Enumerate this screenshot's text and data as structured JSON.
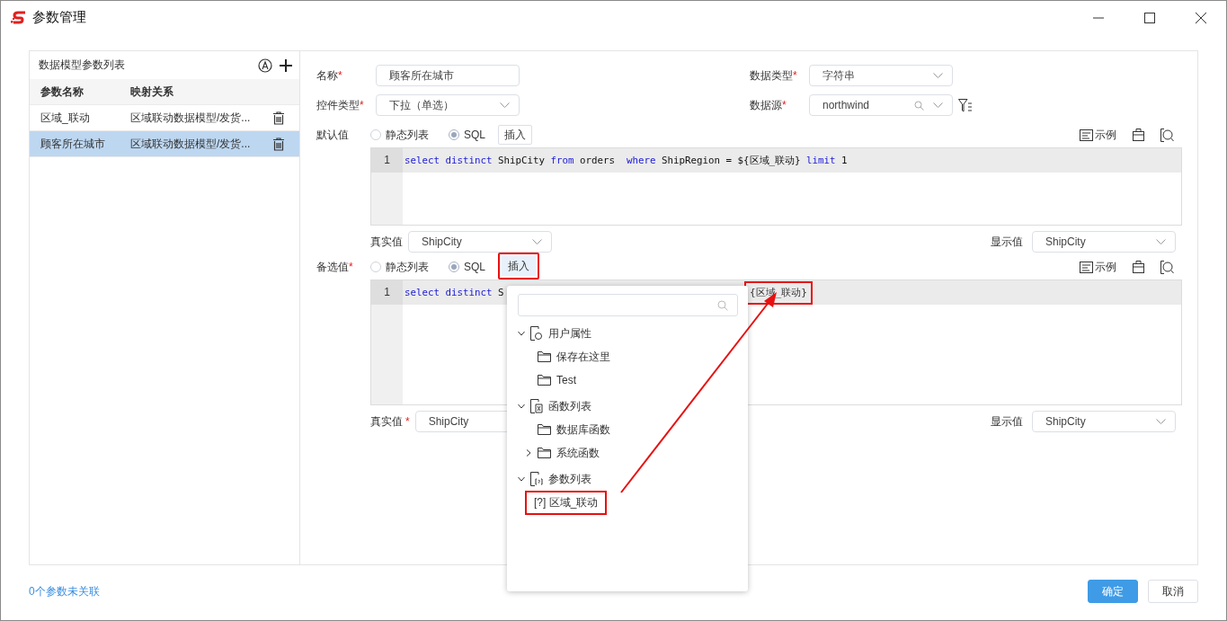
{
  "window": {
    "title": "参数管理"
  },
  "param_list": {
    "title": "数据模型参数列表",
    "columns": [
      "参数名称",
      "映射关系"
    ],
    "rows": [
      {
        "name": "区域_联动",
        "mapping": "区域联动数据模型/发货...",
        "selected": false
      },
      {
        "name": "顾客所在城市",
        "mapping": "区域联动数据模型/发货...",
        "selected": true
      }
    ]
  },
  "form": {
    "name": {
      "label": "名称",
      "required_mark": "*",
      "value": "顾客所在城市"
    },
    "data_type": {
      "label": "数据类型",
      "required_mark": "*",
      "value": "字符串"
    },
    "control_type": {
      "label": "控件类型",
      "required_mark": "*",
      "value": "下拉（单选）"
    },
    "data_source": {
      "label": "数据源",
      "required_mark": "*",
      "value": "northwind"
    }
  },
  "sections": [
    {
      "label": "默认值",
      "options": [
        {
          "label": "静态列表",
          "selected": false
        },
        {
          "label": "SQL",
          "selected": true
        }
      ],
      "insert_button": {
        "label": "插入",
        "highlighted": false
      },
      "example_label": "示例",
      "kind": "short",
      "line_number": "1",
      "segments": [
        {
          "text": "select distinct",
          "kind": "keyword"
        },
        {
          "text": " ShipCity ",
          "kind": "plain"
        },
        {
          "text": "from",
          "kind": "keyword"
        },
        {
          "text": " orders  ",
          "kind": "plain"
        },
        {
          "text": "where",
          "kind": "keyword"
        },
        {
          "text": " ShipRegion = ${区域_联动} ",
          "kind": "plain"
        },
        {
          "text": "limit",
          "kind": "keyword"
        },
        {
          "text": " 1",
          "kind": "plain"
        }
      ],
      "real_value": {
        "label": "真实值",
        "value": "ShipCity"
      },
      "display_value": {
        "label": "显示值",
        "value": "ShipCity"
      }
    },
    {
      "label": "备选值",
      "required_mark": "*",
      "options": [
        {
          "label": "静态列表",
          "selected": false
        },
        {
          "label": "SQL",
          "selected": true
        }
      ],
      "insert_button": {
        "label": "插入",
        "highlighted": true
      },
      "example_label": "示例",
      "kind": "tall",
      "line_number": "1",
      "segments": [
        {
          "text": "select distinct",
          "kind": "keyword"
        },
        {
          "text": " S",
          "kind": "plain"
        }
      ],
      "tail": {
        "text": "{区域_联动}",
        "highlighted": true
      },
      "real_value": {
        "label": "真实值",
        "required_mark": "*",
        "value": "ShipCity"
      },
      "display_value": {
        "label": "显示值",
        "value": "ShipCity"
      }
    }
  ],
  "insert_popup": {
    "tree": [
      {
        "label": "用户属性",
        "kind": "user",
        "expanded": true,
        "children": [
          {
            "label": "保存在这里",
            "kind": "folder"
          },
          {
            "label": "Test",
            "kind": "folder"
          }
        ]
      },
      {
        "label": "函数列表",
        "kind": "function",
        "expanded": true,
        "children": [
          {
            "label": "数据库函数",
            "kind": "folder"
          },
          {
            "label": "系统函数",
            "kind": "folder",
            "expanded": false
          }
        ]
      },
      {
        "label": "参数列表",
        "kind": "params",
        "expanded": true,
        "children": [
          {
            "label": "区域_联动",
            "kind": "param",
            "prefix": "[?]",
            "highlighted": true
          }
        ]
      }
    ]
  },
  "footer": {
    "unlinked_link": "0个参数未关联",
    "buttons": [
      {
        "label": "确定",
        "kind": "primary"
      },
      {
        "label": "取消",
        "kind": "secondary"
      }
    ]
  }
}
